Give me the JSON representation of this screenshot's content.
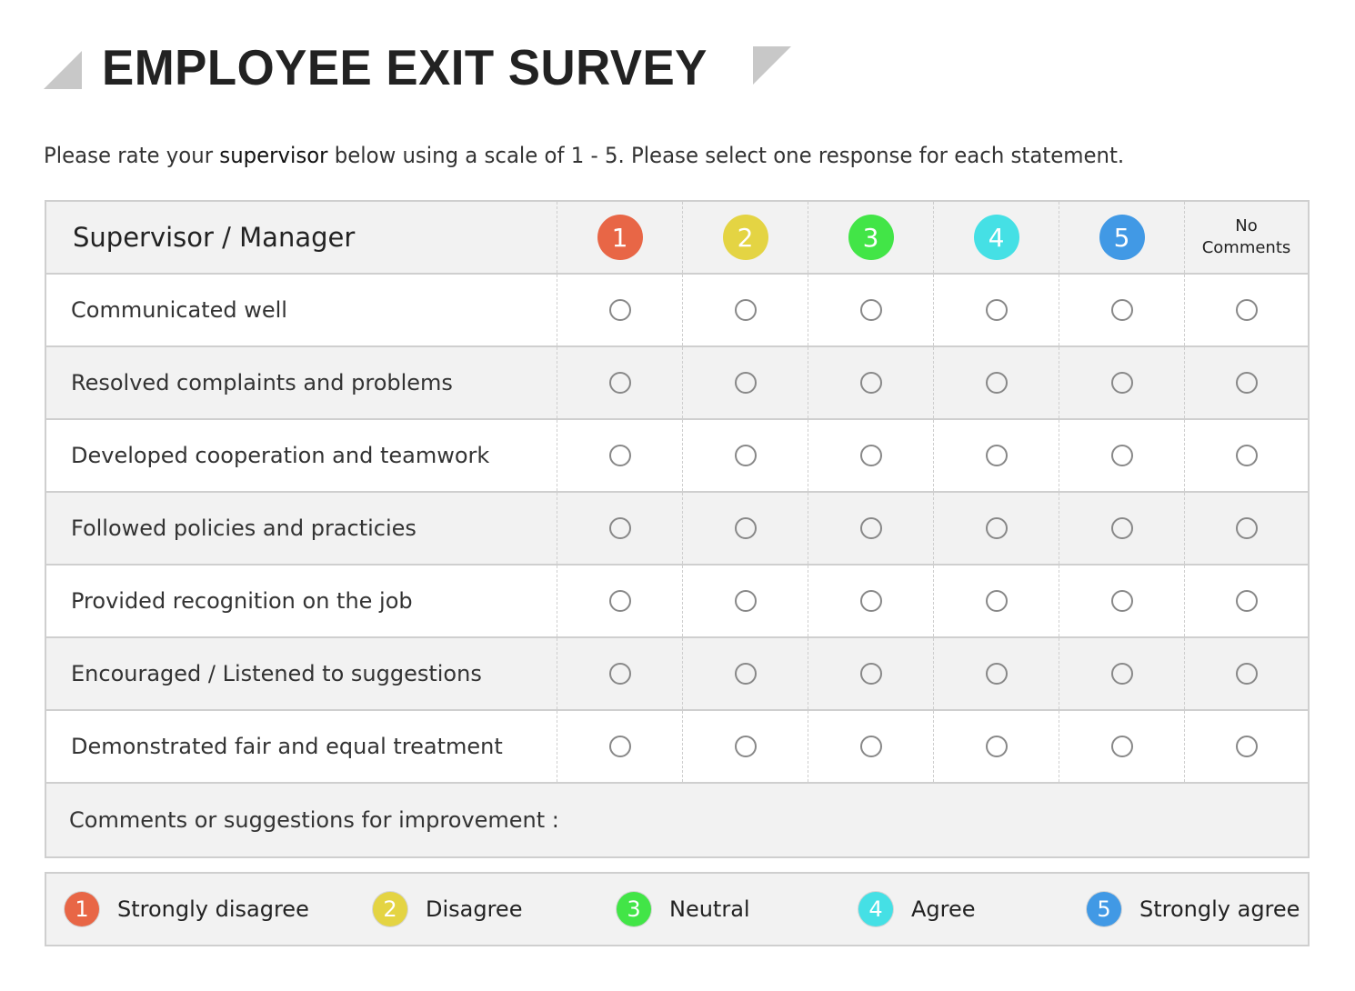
{
  "title": "EMPLOYEE EXIT SURVEY",
  "instructions": {
    "before": "Please rate your ",
    "emphasis": "supervisor",
    "after": " below using a scale of 1 - 5. Please select one response for each statement."
  },
  "table": {
    "header_label": "Supervisor / Manager",
    "scale": [
      {
        "value": "1",
        "color": "#e86646"
      },
      {
        "value": "2",
        "color": "#e4d443"
      },
      {
        "value": "3",
        "color": "#42e547"
      },
      {
        "value": "4",
        "color": "#45e0e5"
      },
      {
        "value": "5",
        "color": "#4199e5"
      }
    ],
    "no_comments_label_line1": "No",
    "no_comments_label_line2": "Comments",
    "statements": [
      "Communicated well",
      "Resolved complaints and problems",
      "Developed cooperation and teamwork",
      "Followed policies and practicies",
      "Provided recognition on the job",
      "Encouraged / Listened to suggestions",
      "Demonstrated fair and equal treatment"
    ],
    "comments_label": "Comments or suggestions for improvement :"
  },
  "legend": [
    {
      "value": "1",
      "label": "Strongly disagree",
      "color": "#e86646"
    },
    {
      "value": "2",
      "label": "Disagree",
      "color": "#e4d443"
    },
    {
      "value": "3",
      "label": "Neutral",
      "color": "#42e547"
    },
    {
      "value": "4",
      "label": "Agree",
      "color": "#45e0e5"
    },
    {
      "value": "5",
      "label": "Strongly agree",
      "color": "#4199e5"
    }
  ]
}
